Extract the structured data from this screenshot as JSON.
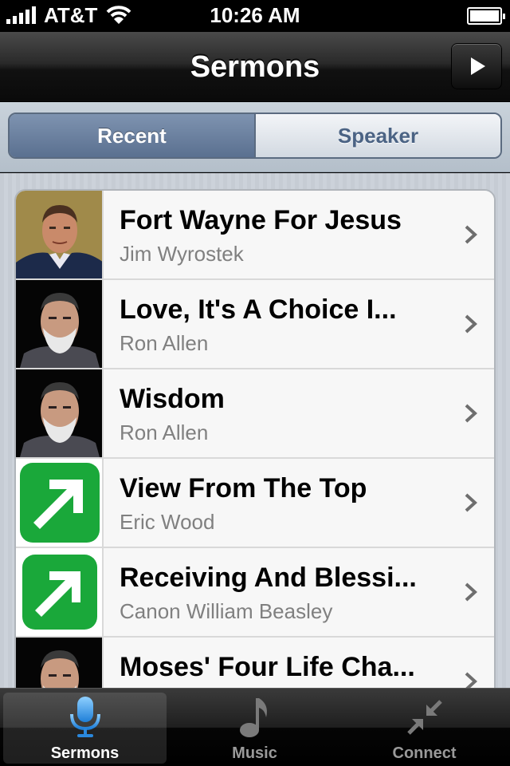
{
  "status_bar": {
    "carrier": "AT&T",
    "time": "10:26 AM",
    "battery_level": 1.0
  },
  "nav_bar": {
    "title": "Sermons",
    "play_icon": "play-icon"
  },
  "segmented_control": {
    "segments": [
      "Recent",
      "Speaker"
    ],
    "selected": "Recent"
  },
  "sermons": [
    {
      "title": "Fort Wayne For Jesus",
      "speaker": "Jim Wyrostek",
      "thumbnail": "speaker-photo"
    },
    {
      "title": "Love, It's A Choice I...",
      "speaker": "Ron Allen",
      "thumbnail": "speaker-photo"
    },
    {
      "title": "Wisdom",
      "speaker": "Ron Allen",
      "thumbnail": "speaker-photo"
    },
    {
      "title": "View From The Top",
      "speaker": "Eric Wood",
      "thumbnail": "green-arrow-logo"
    },
    {
      "title": "Receiving And Blessi...",
      "speaker": "Canon William Beasley",
      "thumbnail": "green-arrow-logo"
    },
    {
      "title": "Moses' Four Life Cha...",
      "speaker": "",
      "thumbnail": "speaker-photo"
    }
  ],
  "tab_bar": {
    "tabs": [
      {
        "label": "Sermons",
        "icon": "microphone-icon",
        "active": true
      },
      {
        "label": "Music",
        "icon": "music-note-icon",
        "active": false
      },
      {
        "label": "Connect",
        "icon": "connect-arrows-icon",
        "active": false
      }
    ]
  },
  "colors": {
    "segment_selected": "#6b82a3",
    "segment_text": "#4b6384",
    "tab_active_icon": "#4aa3f0",
    "logo_green": "#1aa83a"
  }
}
